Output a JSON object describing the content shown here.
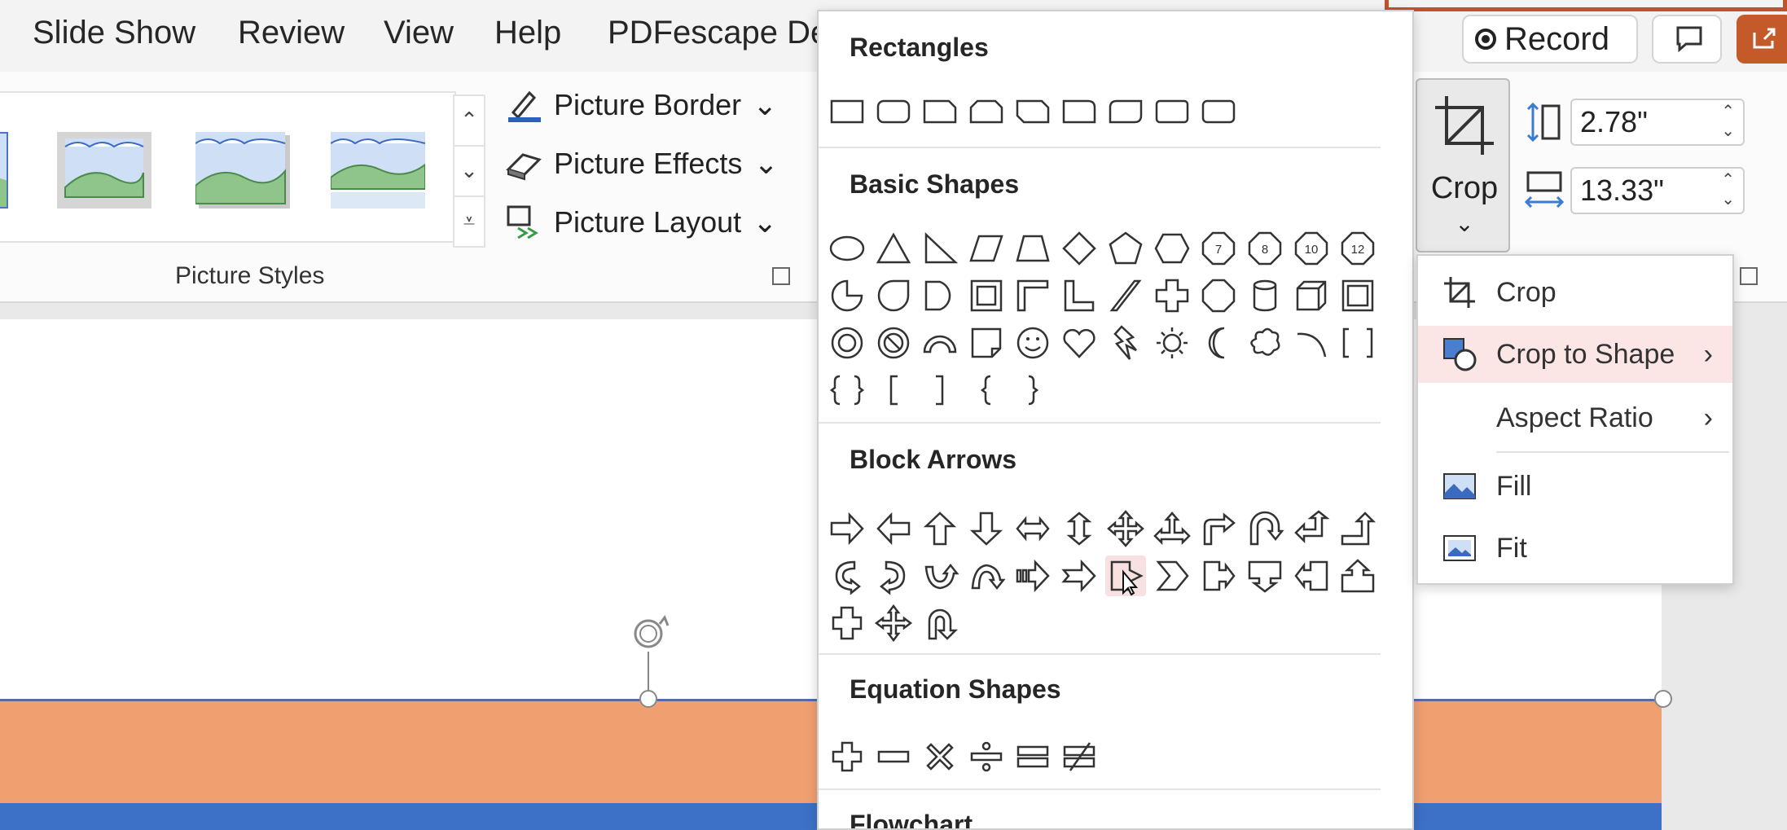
{
  "menubar": {
    "items": [
      "Slide Show",
      "Review",
      "View",
      "Help",
      "PDFescape De"
    ],
    "record_label": "Record"
  },
  "ribbon": {
    "group_label": "Picture Styles",
    "commands": {
      "picture_border": "Picture Border",
      "picture_effects": "Picture Effects",
      "picture_layout": "Picture Layout"
    },
    "crop_label": "Crop",
    "height_value": "2.78\"",
    "width_value": "13.33\""
  },
  "shape_menu": {
    "categories": {
      "rectangles": "Rectangles",
      "basic_shapes": "Basic Shapes",
      "block_arrows": "Block Arrows",
      "equation_shapes": "Equation Shapes",
      "flowchart": "Flowchart"
    },
    "octagon_numbers": [
      "7",
      "8",
      "10",
      "12"
    ]
  },
  "crop_menu": {
    "items": [
      "Crop",
      "Crop to Shape",
      "Aspect Ratio",
      "Fill",
      "Fit"
    ],
    "active": "Crop to Shape"
  },
  "colors": {
    "accent": "#c45a2a",
    "orange_band": "#f0a070",
    "blue_band": "#3d71c7",
    "menu_highlight": "#fbe5e5"
  }
}
